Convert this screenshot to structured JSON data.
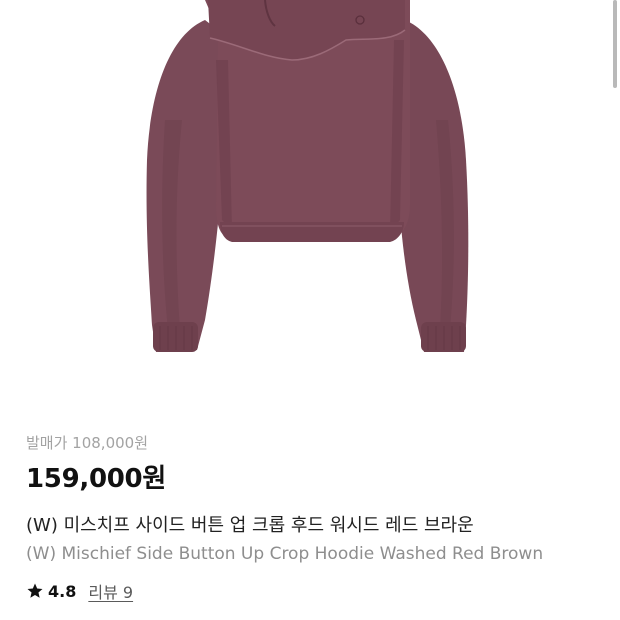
{
  "product": {
    "image_alt": "washed red brown cropped hoodie",
    "release_price": "발매가 108,000원",
    "price": "159,000원",
    "title_ko": "(W) 미스치프 사이드 버튼 업 크롭 후드 워시드 레드 브라운",
    "title_en": "(W) Mischief Side Button Up Crop Hoodie Washed Red Brown",
    "rating": "4.8",
    "reviews": "리뷰 9",
    "star_icon": "star-icon"
  },
  "colors": {
    "hoodie": "#7a4a58",
    "hoodie_shadow": "#5e3542",
    "hoodie_light": "#8e5c6a",
    "price_text": "#111111",
    "muted_text": "#a3a3a3"
  }
}
